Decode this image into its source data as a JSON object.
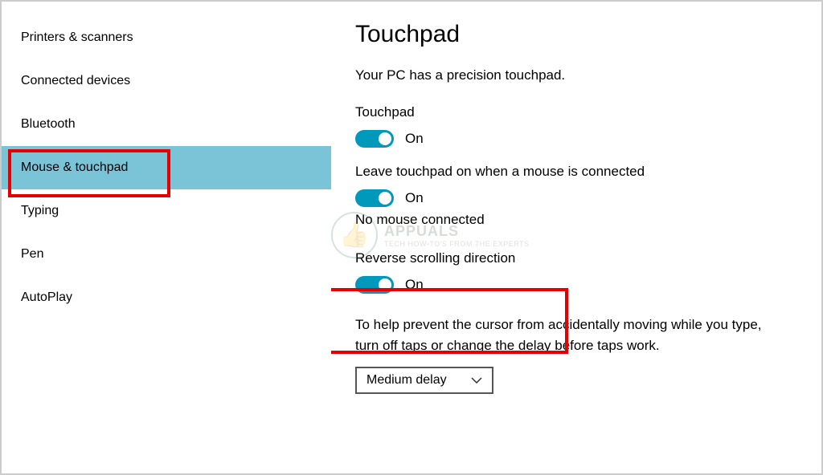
{
  "sidebar": {
    "items": [
      {
        "label": "Printers & scanners"
      },
      {
        "label": "Connected devices"
      },
      {
        "label": "Bluetooth"
      },
      {
        "label": "Mouse & touchpad"
      },
      {
        "label": "Typing"
      },
      {
        "label": "Pen"
      },
      {
        "label": "AutoPlay"
      }
    ]
  },
  "main": {
    "title": "Touchpad",
    "description": "Your PC has a precision touchpad.",
    "touchpad_label": "Touchpad",
    "touchpad_state": "On",
    "leave_on_label": "Leave touchpad on when a mouse is connected",
    "leave_on_state": "On",
    "mouse_status": "No mouse connected",
    "reverse_label": "Reverse scrolling direction",
    "reverse_state": "On",
    "help_text": "To help prevent the cursor from accidentally moving while you type, turn off taps or change the delay before taps work.",
    "delay_selected": "Medium delay"
  },
  "watermark": {
    "title": "APPUALS",
    "subtitle": "TECH HOW-TO'S FROM THE EXPERTS"
  }
}
